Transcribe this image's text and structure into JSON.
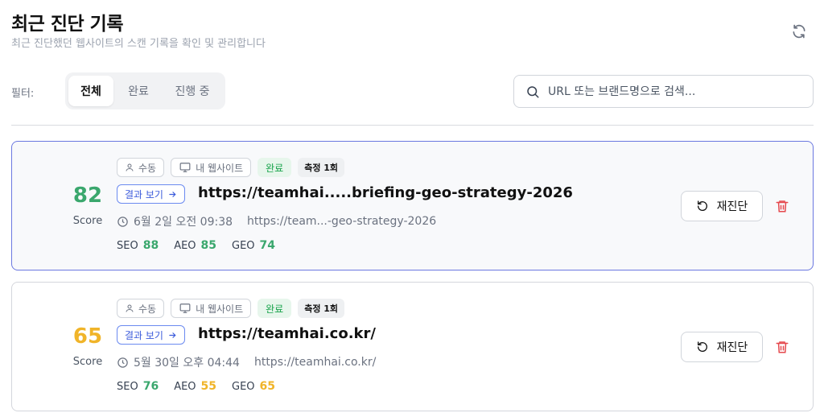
{
  "header": {
    "title": "최근 진단 기록",
    "subtitle": "최근 진단했던 웹사이트의 스캔 기록을 확인 및 관리합니다",
    "refresh_icon": "refresh-icon"
  },
  "filters": {
    "label": "필터:",
    "options": [
      "전체",
      "완료",
      "진행 중"
    ],
    "selected": "전체"
  },
  "search": {
    "placeholder": "URL 또는 브랜드명으로 검색...",
    "value": ""
  },
  "colors": {
    "accent": "#6b78e0",
    "good": "#3aa76d",
    "warn": "#f0b429",
    "delete": "#e5484d",
    "done_bg": "#e7f6ec"
  },
  "records": [
    {
      "score": "82",
      "score_label": "Score",
      "score_color": "#3aa76d",
      "tag_mode": "수동",
      "tag_site": "내 웹사이트",
      "tag_status": "완료",
      "tag_count": "측정 1회",
      "result_label": "결과 보기",
      "url_title": "https://teamhai.....briefing-geo-strategy-2026",
      "date": "6월 2일 오전 09:38",
      "url_sub": "https://team...-geo-strategy-2026",
      "metrics": [
        {
          "label": "SEO",
          "value": "88",
          "color": "#3aa76d"
        },
        {
          "label": "AEO",
          "value": "85",
          "color": "#3aa76d"
        },
        {
          "label": "GEO",
          "value": "74",
          "color": "#3aa76d"
        }
      ],
      "rediag_label": "재진단"
    },
    {
      "score": "65",
      "score_label": "Score",
      "score_color": "#f0b429",
      "tag_mode": "수동",
      "tag_site": "내 웹사이트",
      "tag_status": "완료",
      "tag_count": "측정 1회",
      "result_label": "결과 보기",
      "url_title": "https://teamhai.co.kr/",
      "date": "5월 30일 오후 04:44",
      "url_sub": "https://teamhai.co.kr/",
      "metrics": [
        {
          "label": "SEO",
          "value": "76",
          "color": "#3aa76d"
        },
        {
          "label": "AEO",
          "value": "55",
          "color": "#f0b429"
        },
        {
          "label": "GEO",
          "value": "65",
          "color": "#f0b429"
        }
      ],
      "rediag_label": "재진단"
    }
  ]
}
